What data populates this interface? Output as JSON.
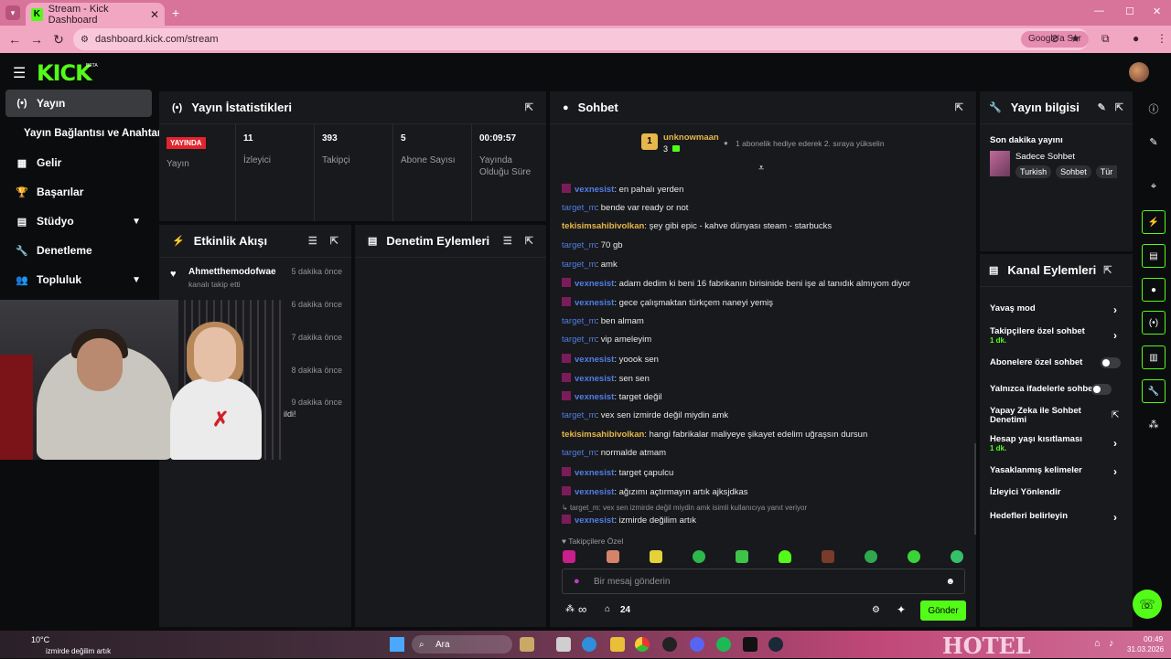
{
  "browser": {
    "tab_title": "Stream - Kick Dashboard",
    "tab_close": "✕",
    "new_tab": "+",
    "url": "dashboard.kick.com/stream",
    "google_btn": "Google'a Sor",
    "win_min": "—",
    "win_max": "☐",
    "win_close": "✕"
  },
  "topnav": {
    "logo": "KICK",
    "beta": "BETA"
  },
  "sidebar": {
    "items": [
      {
        "label": "Yayın",
        "icon": "(•)"
      },
      {
        "label": "Yayın Bağlantısı ve Anahtarı",
        "icon": ""
      },
      {
        "label": "Gelir",
        "icon": "▦"
      },
      {
        "label": "Başarılar",
        "icon": "🏆"
      },
      {
        "label": "Stüdyo",
        "icon": "▤"
      },
      {
        "label": "Denetleme",
        "icon": "🔧"
      },
      {
        "label": "Topluluk",
        "icon": "👥"
      }
    ]
  },
  "stats": {
    "title": "Yayın İstatistikleri",
    "live_badge": "YAYINDA",
    "cells": [
      {
        "value": "",
        "label": "Yayın"
      },
      {
        "value": "11",
        "label": "İzleyici"
      },
      {
        "value": "393",
        "label": "Takipçi"
      },
      {
        "value": "5",
        "label": "Abone Sayısı"
      },
      {
        "value": "00:09:57",
        "label": "Yayında Olduğu Süre"
      }
    ]
  },
  "events": {
    "title": "Etkinlik Akışı",
    "first_user": "Ahmetthemodofwae",
    "first_action": "kanalı takip etti",
    "first_time": "5 dakika önce",
    "times": [
      "6 dakika önce",
      "7 dakika önce",
      "8 dakika önce",
      "9 dakika önce"
    ],
    "partial": "ildi!"
  },
  "moderation": {
    "title": "Denetim Eylemleri"
  },
  "chat": {
    "title": "Sohbet",
    "pinned_user": "unknowmaan",
    "pinned_count": "3",
    "pinned_text": "1 abonelik hediye ederek 2. sıraya yükselin",
    "messages": [
      {
        "user": "vexnesist",
        "type": "vex",
        "text": ": en pahalı yerden"
      },
      {
        "user": "target_m",
        "type": "tgt",
        "text": ": bende var ready or not"
      },
      {
        "user": "tekisimsahibivolkan",
        "type": "tek",
        "text": ": şey gibi epic - kahve dünyası steam - starbucks"
      },
      {
        "user": "target_m",
        "type": "tgt",
        "text": ": 70 gb"
      },
      {
        "user": "target_m",
        "type": "tgt",
        "text": ": amk"
      },
      {
        "user": "vexnesist",
        "type": "vex",
        "text": ": adam dedim ki beni 16 fabrikanın birisinide beni işe al tanıdık almıyom diyor"
      },
      {
        "user": "vexnesist",
        "type": "vex",
        "text": ": gece çalışmaktan türkçem naneyi yemiş"
      },
      {
        "user": "target_m",
        "type": "tgt",
        "text": ": ben almam"
      },
      {
        "user": "target_m",
        "type": "tgt",
        "text": ": vip ameleyim"
      },
      {
        "user": "vexnesist",
        "type": "vex",
        "text": ": yoook sen"
      },
      {
        "user": "vexnesist",
        "type": "vex",
        "text": ": sen sen"
      },
      {
        "user": "vexnesist",
        "type": "vex",
        "text": ": target değil"
      },
      {
        "user": "target_m",
        "type": "tgt",
        "text": ": vex sen izmirde değil miydin amk"
      },
      {
        "user": "tekisimsahibivolkan",
        "type": "tek",
        "text": ": hangi fabrikalar maliyeye şikayet edelim uğraşsın dursun"
      },
      {
        "user": "target_m",
        "type": "tgt",
        "text": ": normalde atmam"
      },
      {
        "user": "vexnesist",
        "type": "vex",
        "text": ": target çapulcu"
      },
      {
        "user": "vexnesist",
        "type": "vex",
        "text": ": ağızımı açtırmayın artık ajksjdkas"
      }
    ],
    "reply_note": "target_m: vex sen izmirde değil miydin amk isimli kullanıcıya yanıt veriyor",
    "last_user": "vexnesist",
    "last_text": ": izmirde değilim artık",
    "emote_section": "Takipçilere Özel",
    "input_placeholder": "Bir mesaj gönderin",
    "count": "24",
    "infinity": "∞",
    "send": "Gönder"
  },
  "stream_info": {
    "title": "Yayın bilgisi",
    "heading": "Son dakika yayını",
    "category": "Sadece Sohbet",
    "tags": [
      "Turkish",
      "Sohbet",
      "Tür"
    ]
  },
  "channel_actions": {
    "title": "Kanal Eylemleri",
    "rows": [
      {
        "label": "Yavaş mod",
        "sub": "",
        "ctl": "chev"
      },
      {
        "label": "Takipçilere özel sohbet",
        "sub": "1 dk.",
        "ctl": "chev"
      },
      {
        "label": "Abonelere özel sohbet",
        "sub": "",
        "ctl": "toggle"
      },
      {
        "label": "Yalnızca ifadelerle sohbet",
        "sub": "",
        "ctl": "toggle"
      },
      {
        "label": "Yapay Zeka ile Sohbet Denetimi",
        "sub": "",
        "ctl": "ext"
      },
      {
        "label": "Hesap yaşı kısıtlaması",
        "sub": "1 dk.",
        "ctl": "chev"
      },
      {
        "label": "Yasaklanmış kelimeler",
        "sub": "",
        "ctl": "chev"
      },
      {
        "label": "İzleyici Yönlendir",
        "sub": "",
        "ctl": "none"
      },
      {
        "label": "Hedefleri belirleyin",
        "sub": "",
        "ctl": "chev"
      }
    ]
  },
  "taskbar": {
    "search": "Ara",
    "weather": "10°C",
    "overlay_text": "izmirde değilim artık",
    "time": "00:49",
    "date": "31.03.2026",
    "hotel": "HOTEL"
  },
  "colors": {
    "kick_green": "#53fc18",
    "panel": "#18191c",
    "live_red": "#e0252e"
  }
}
